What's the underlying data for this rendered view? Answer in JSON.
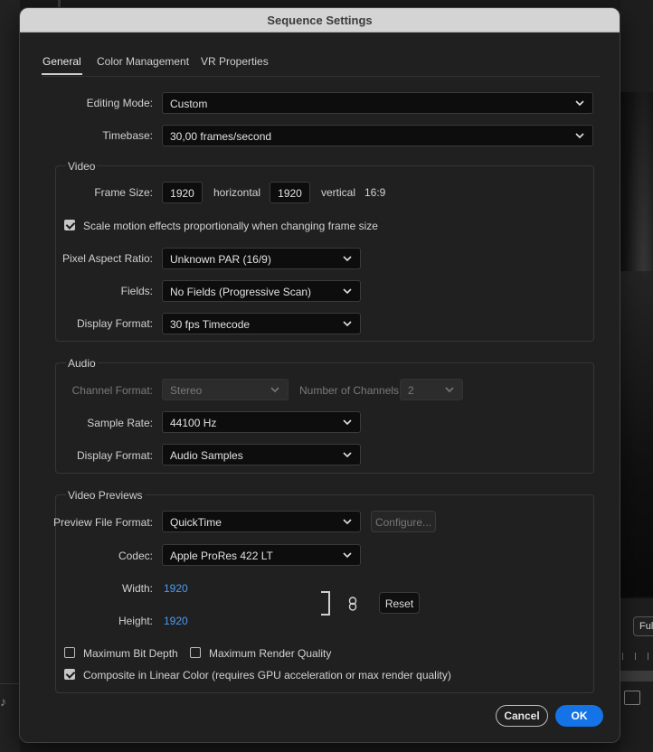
{
  "dialog": {
    "title": "Sequence Settings"
  },
  "tabs": [
    {
      "label": "General",
      "active": true
    },
    {
      "label": "Color Management",
      "active": false
    },
    {
      "label": "VR Properties",
      "active": false
    }
  ],
  "general": {
    "editing_mode": {
      "label": "Editing Mode:",
      "value": "Custom"
    },
    "timebase": {
      "label": "Timebase:",
      "value": "30,00  frames/second"
    }
  },
  "video": {
    "title": "Video",
    "frame_size": {
      "label": "Frame Size:",
      "horizontal": "1920",
      "horizontal_label": "horizontal",
      "vertical": "1920",
      "vertical_label": "vertical",
      "aspect": "16:9"
    },
    "scale_motion": {
      "label": "Scale motion effects proportionally when changing frame size",
      "checked": true
    },
    "pixel_aspect_ratio": {
      "label": "Pixel Aspect Ratio:",
      "value": "Unknown PAR (16/9)"
    },
    "fields": {
      "label": "Fields:",
      "value": "No Fields (Progressive Scan)"
    },
    "display_format": {
      "label": "Display Format:",
      "value": "30 fps Timecode"
    }
  },
  "audio": {
    "title": "Audio",
    "channel_format": {
      "label": "Channel Format:",
      "value": "Stereo"
    },
    "number_of_channels": {
      "label": "Number of Channels:",
      "value": "2"
    },
    "sample_rate": {
      "label": "Sample Rate:",
      "value": "44100 Hz"
    },
    "display_format": {
      "label": "Display Format:",
      "value": "Audio Samples"
    }
  },
  "previews": {
    "title": "Video Previews",
    "file_format": {
      "label": "Preview File Format:",
      "value": "QuickTime"
    },
    "configure_label": "Configure...",
    "codec": {
      "label": "Codec:",
      "value": "Apple ProRes 422 LT"
    },
    "width": {
      "label": "Width:",
      "value": "1920"
    },
    "height": {
      "label": "Height:",
      "value": "1920"
    },
    "reset_label": "Reset",
    "max_bit_depth": {
      "label": "Maximum Bit Depth",
      "checked": false
    },
    "max_render_quality": {
      "label": "Maximum Render Quality",
      "checked": false
    },
    "linear_color": {
      "label": "Composite in Linear Color (requires GPU acceleration or max render quality)",
      "checked": true
    }
  },
  "footer": {
    "cancel_label": "Cancel",
    "ok_label": "OK"
  },
  "background": {
    "right_dropdown_text": "Ful"
  },
  "colors": {
    "accent": "#1473e6",
    "link_value": "#4d9bf2"
  }
}
